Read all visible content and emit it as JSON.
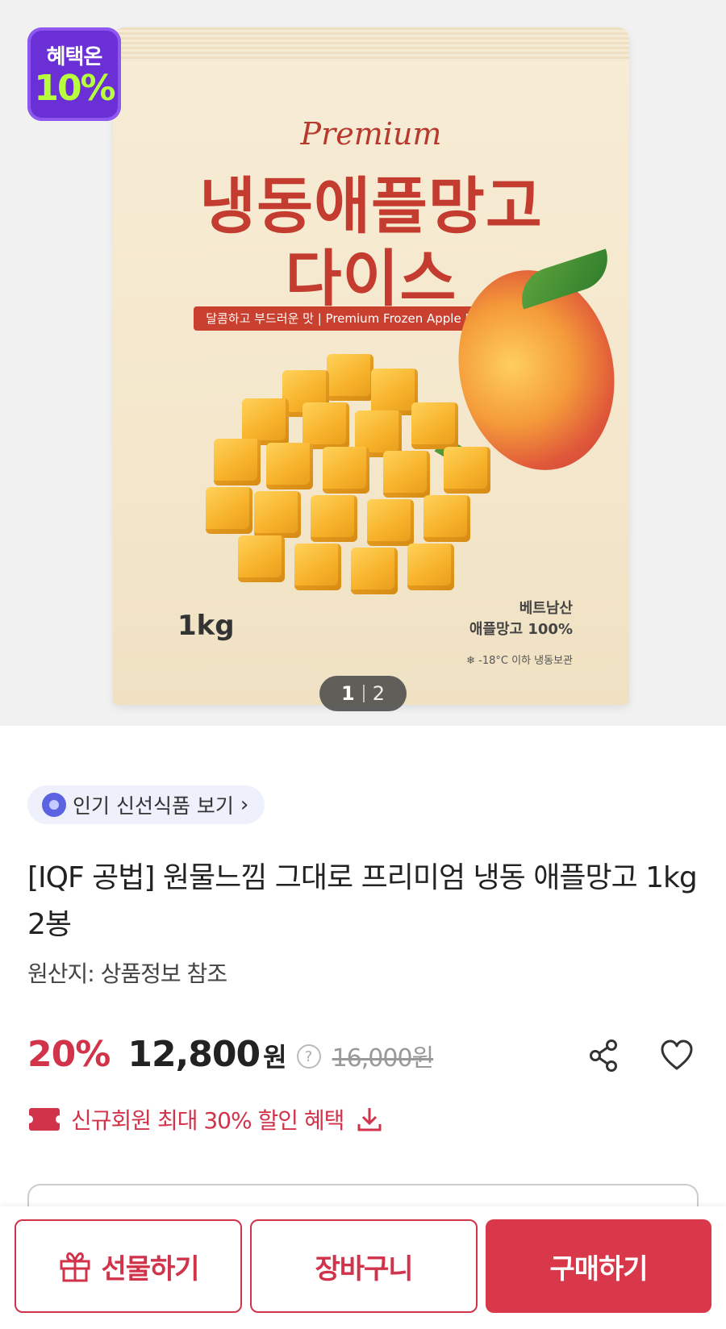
{
  "hero": {
    "pouch": {
      "premium": "Premium",
      "title_line1": "냉동애플망고",
      "title_line2": "다이스",
      "band": "달콤하고 부드러운 맛 | Premium Frozen Apple Mango Dice",
      "weight": "1kg",
      "origin_line1": "베트남산",
      "origin_line2": "애플망고 100%",
      "storage": "❄ -18°C 이하 냉동보관"
    },
    "badge": {
      "top": "혜택온",
      "value": "10%"
    },
    "pager": {
      "current": "1",
      "total": "2"
    }
  },
  "popular_link": {
    "label": "인기 신선식품 보기",
    "icon": "medal-icon"
  },
  "product": {
    "title": "[IQF 공법] 원물느낌 그대로 프리미엄 냉동 애플망고 1kg 2봉",
    "origin": "원산지: 상품정보 참조"
  },
  "price": {
    "discount": "20%",
    "sale": "12,800",
    "currency": "원",
    "help": "?",
    "original": "16,000원"
  },
  "coupon": {
    "label": "신규회원 최대 30% 할인 혜택"
  },
  "bottom_bar": {
    "gift": "선물하기",
    "cart": "장바구니",
    "buy": "구매하기"
  },
  "colors": {
    "accent": "#d0334a",
    "badge": "#6b2fd6",
    "badge_value": "#b6ff3a"
  }
}
